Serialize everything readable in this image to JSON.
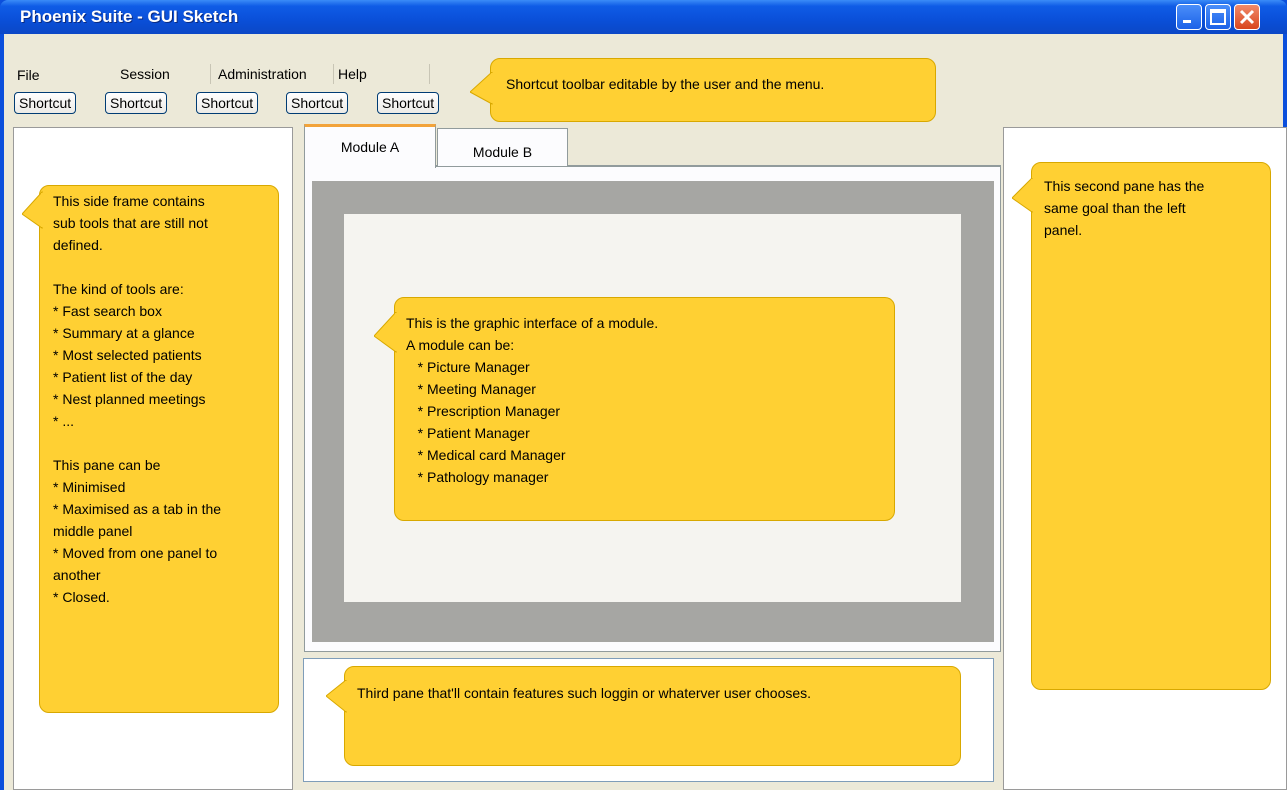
{
  "window": {
    "title": "Phoenix Suite - GUI Sketch"
  },
  "menu": {
    "items": [
      "File",
      "Session",
      "Administration",
      "Help"
    ]
  },
  "toolbar": {
    "shortcuts": [
      "Shortcut",
      "Shortcut",
      "Shortcut",
      "Shortcut",
      "Shortcut"
    ]
  },
  "tabs": [
    {
      "label": "Module A",
      "active": true
    },
    {
      "label": "Module B",
      "active": false
    }
  ],
  "notes": {
    "toolbar": "Shortcut toolbar editable by the user and the menu.",
    "left": [
      "This side frame contains",
      "sub tools that are still not",
      "defined.",
      "",
      "The kind of tools are:",
      "* Fast search box",
      "* Summary at a glance",
      "* Most selected patients",
      "* Patient list of the day",
      "* Nest planned meetings",
      "* ...",
      "",
      "This pane can be",
      "* Minimised",
      "* Maximised as a tab in the",
      "middle panel",
      "* Moved from one panel to",
      "another",
      "* Closed."
    ],
    "right": [
      "This second pane has the",
      "same goal than the left",
      "panel."
    ],
    "module": [
      "This is the graphic interface of a module.",
      "A module can be:",
      "   * Picture Manager",
      "   * Meeting Manager",
      "   * Prescription Manager",
      "   * Patient Manager",
      "   * Medical card Manager",
      "   * Pathology manager"
    ],
    "third": "Third pane that'll contain features such loggin or whaterver user chooses."
  },
  "colors": {
    "titlebar": "#0a4fd8",
    "note": "#ffd033",
    "tab_accent": "#f2a33a",
    "module_frame": "#a6a6a3"
  }
}
